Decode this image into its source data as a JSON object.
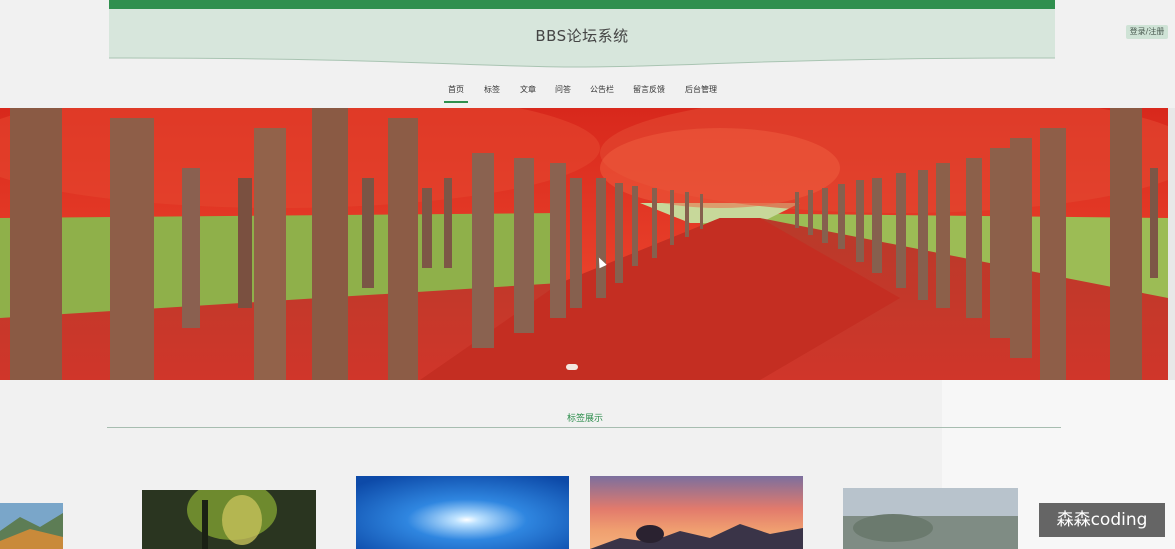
{
  "header": {
    "title": "BBS论坛系统",
    "login_label": "登录/注册"
  },
  "nav": {
    "items": [
      {
        "label": "首页"
      },
      {
        "label": "标签"
      },
      {
        "label": "文章"
      },
      {
        "label": "问答"
      },
      {
        "label": "公告栏"
      },
      {
        "label": "留言反馈"
      },
      {
        "label": "后台管理"
      }
    ],
    "active": "首页"
  },
  "banner": {
    "image": "red-maple-tree-avenue",
    "slide_count": 1,
    "current_slide": 1
  },
  "section": {
    "title": "标签展示"
  },
  "cards": [
    {
      "image": "mountain-autumn"
    },
    {
      "image": "dark-forest"
    },
    {
      "image": "blue-sky-sun"
    },
    {
      "image": "sunset-mountains"
    },
    {
      "image": "blurred-landscape"
    }
  ],
  "watermark": {
    "text": "森森coding"
  },
  "colors": {
    "brand_green": "#2f8f4e",
    "header_bg": "#d7e6dc",
    "page_bg": "#f1f1f1"
  }
}
